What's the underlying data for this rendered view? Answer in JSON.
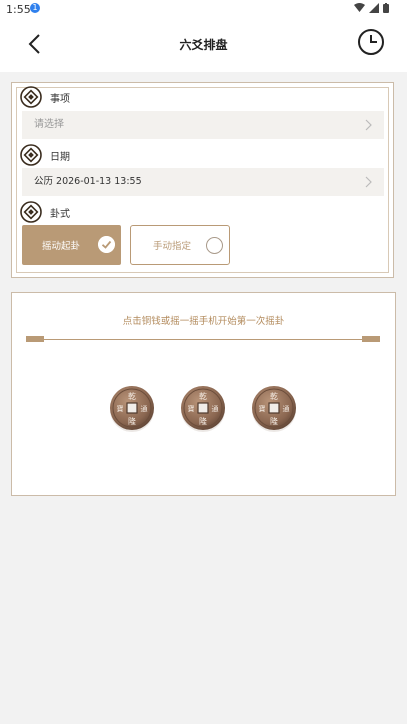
{
  "status_bar": {
    "time": "1:55",
    "notification_badge": "1"
  },
  "header": {
    "title": "六爻排盘"
  },
  "form": {
    "matter": {
      "label": "事项",
      "placeholder": "请选择"
    },
    "date": {
      "label": "日期",
      "value": "公历 2026-01-13 13:55"
    },
    "method": {
      "label": "卦式",
      "options": [
        {
          "label": "摇动起卦",
          "selected": true
        },
        {
          "label": "手动指定",
          "selected": false
        }
      ]
    }
  },
  "casting": {
    "hint": "点击铜钱或摇一摇手机开始第一次摇卦",
    "coins": [
      "乾隆",
      "乾隆",
      "乾隆"
    ]
  },
  "colors": {
    "accent": "#b99a76",
    "hint_text": "#b38b5d",
    "border": "#cbbba8"
  }
}
